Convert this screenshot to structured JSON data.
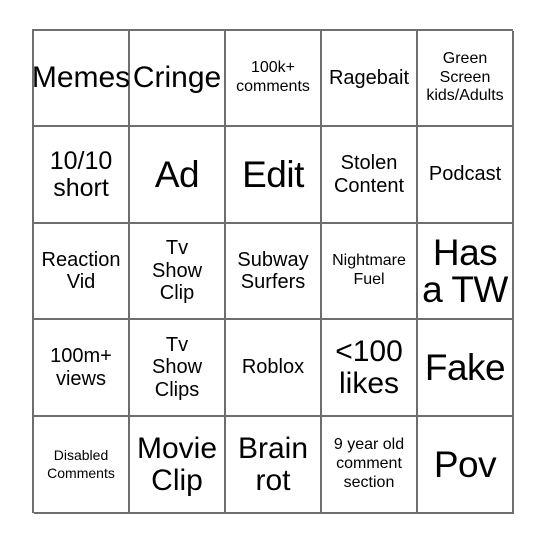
{
  "card": {
    "type": "bingo-card",
    "columns": 5,
    "rows": 5,
    "border_color": "#6e6e6e",
    "text_color": "#000000",
    "background_color": "#ffffff",
    "cells": [
      {
        "text": "Memes",
        "size": "sz-xl"
      },
      {
        "text": "Cringe",
        "size": "sz-xl"
      },
      {
        "text": "100k+\ncomments",
        "size": "sz-s"
      },
      {
        "text": "Ragebait",
        "size": "sz-m"
      },
      {
        "text": "Green\nScreen\nkids/Adults",
        "size": "sz-s"
      },
      {
        "text": "10/10\nshort",
        "size": "sz-l"
      },
      {
        "text": "Ad",
        "size": "sz-xxl"
      },
      {
        "text": "Edit",
        "size": "sz-xxl"
      },
      {
        "text": "Stolen\nContent",
        "size": "sz-m"
      },
      {
        "text": "Podcast",
        "size": "sz-m"
      },
      {
        "text": "Reaction\nVid",
        "size": "sz-m"
      },
      {
        "text": "Tv\nShow\nClip",
        "size": "sz-m"
      },
      {
        "text": "Subway\nSurfers",
        "size": "sz-m"
      },
      {
        "text": "Nightmare\nFuel",
        "size": "sz-s"
      },
      {
        "text": "Has\na TW",
        "size": "sz-xxl"
      },
      {
        "text": "100m+\nviews",
        "size": "sz-m"
      },
      {
        "text": "Tv\nShow\nClips",
        "size": "sz-m"
      },
      {
        "text": "Roblox",
        "size": "sz-m"
      },
      {
        "text": "<100\nlikes",
        "size": "sz-xl"
      },
      {
        "text": "Fake",
        "size": "sz-xxl"
      },
      {
        "text": "Disabled\nComments",
        "size": "sz-xs"
      },
      {
        "text": "Movie\nClip",
        "size": "sz-xl"
      },
      {
        "text": "Brain\nrot",
        "size": "sz-xl"
      },
      {
        "text": "9 year old\ncomment\nsection",
        "size": "sz-s"
      },
      {
        "text": "Pov",
        "size": "sz-xxl"
      }
    ]
  }
}
